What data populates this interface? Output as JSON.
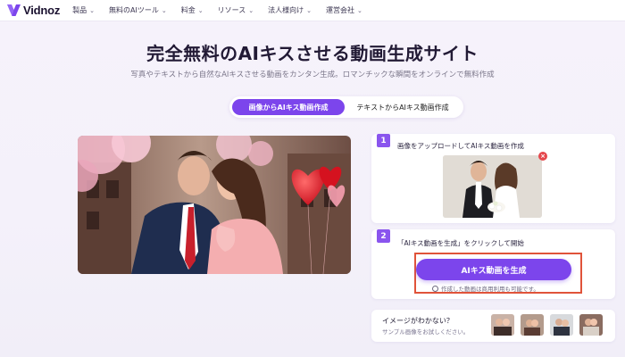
{
  "brand": {
    "name": "Vidnoz",
    "accent": "#7c45ec"
  },
  "nav": {
    "items": [
      {
        "label": "製品",
        "icon": "chevron-down-icon"
      },
      {
        "label": "無料のAIツール",
        "icon": "chevron-down-icon"
      },
      {
        "label": "料金",
        "icon": "chevron-down-icon"
      },
      {
        "label": "リソース",
        "icon": "chevron-down-icon"
      },
      {
        "label": "法人様向け",
        "icon": "chevron-down-icon"
      },
      {
        "label": "運営会社",
        "icon": "chevron-down-icon"
      }
    ]
  },
  "hero": {
    "title": "完全無料のAIキスさせる動画生成サイト",
    "subtitle": "写真やテキストから自然なAIキスさせる動画をカンタン生成。ロマンチックな瞬間をオンラインで無料作成"
  },
  "tabs": [
    {
      "label": "画像からAIキス動画作成",
      "active": true
    },
    {
      "label": "テキストからAIキス動画作成",
      "active": false
    }
  ],
  "steps": [
    {
      "number": "1",
      "text": "画像をアップロードしてAIキス動画を作成"
    },
    {
      "number": "2",
      "text": "「AIキス動画を生成」をクリックして開始"
    }
  ],
  "generate": {
    "button_label": "AIキス動画を生成",
    "note": "作成した動画は商用利用も可能です。",
    "highlight_color": "#e0533a"
  },
  "samples": {
    "title": "イメージがわかない？",
    "subtitle": "サンプル画像をお試しください。"
  }
}
